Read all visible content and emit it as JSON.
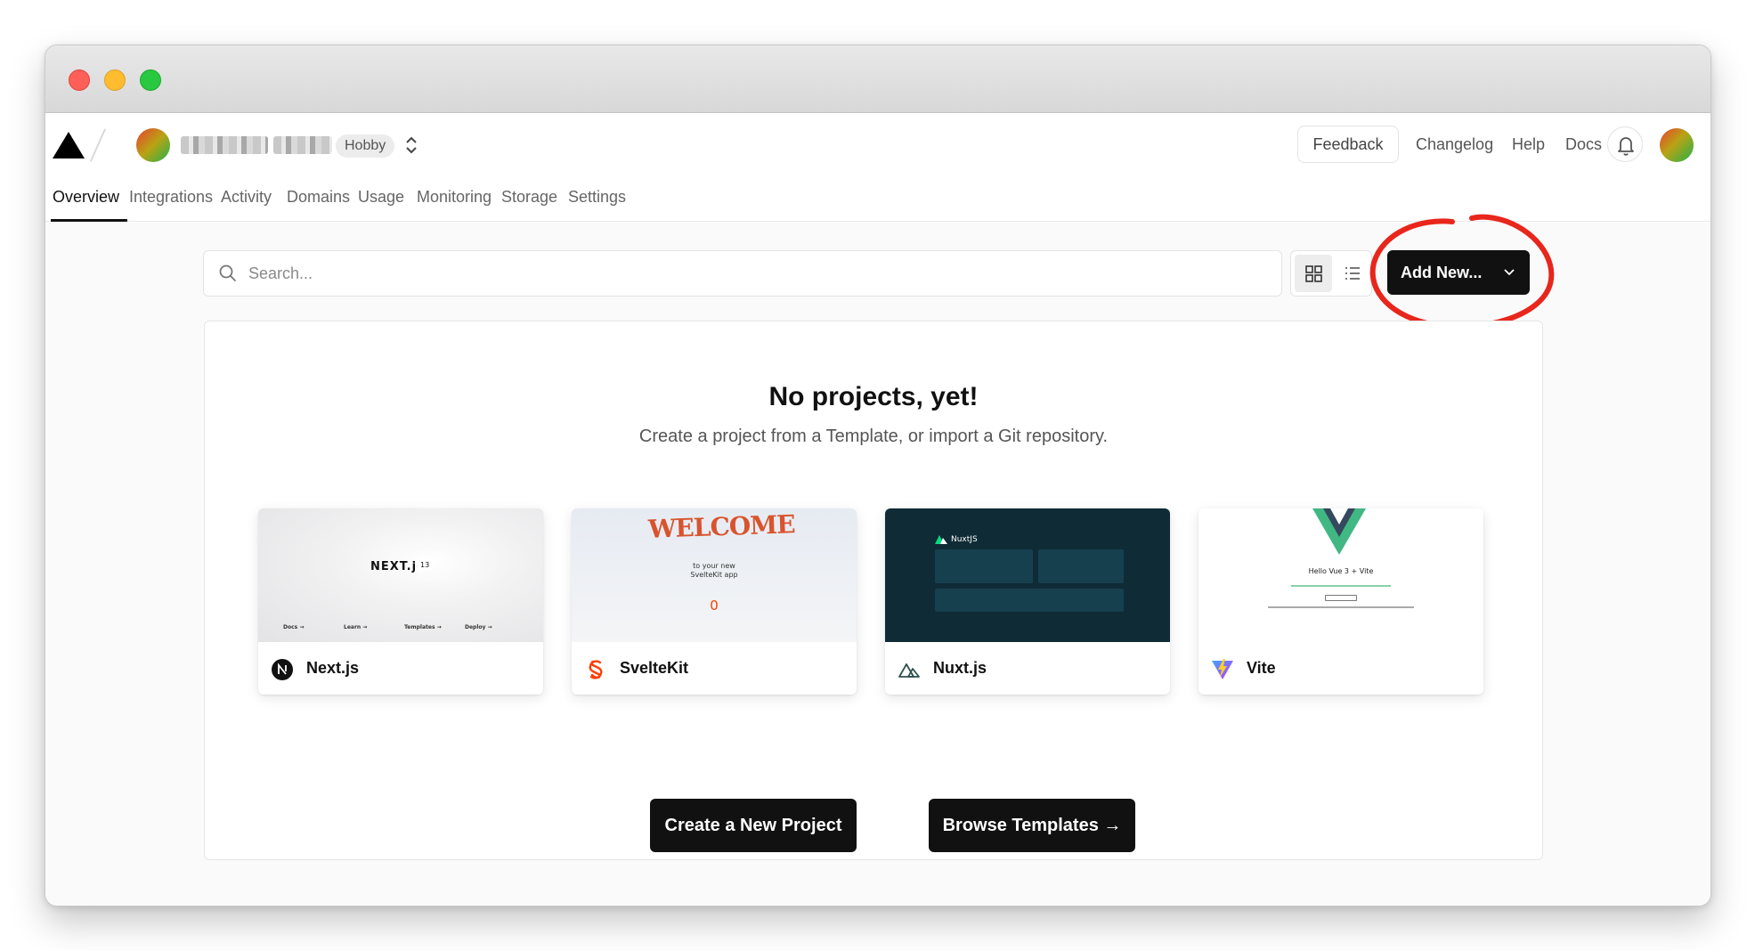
{
  "window": {
    "controls": [
      "close",
      "minimize",
      "zoom"
    ]
  },
  "header": {
    "team": {
      "plan_badge": "Hobby"
    },
    "links": {
      "feedback": "Feedback",
      "changelog": "Changelog",
      "help": "Help",
      "docs": "Docs"
    },
    "icons": {
      "logo": "vercel-triangle-icon",
      "bell": "bell-icon",
      "switcher": "chevron-up-down-icon"
    }
  },
  "tabs": [
    {
      "label": "Overview",
      "active": true
    },
    {
      "label": "Integrations",
      "active": false
    },
    {
      "label": "Activity",
      "active": false
    },
    {
      "label": "Domains",
      "active": false
    },
    {
      "label": "Usage",
      "active": false
    },
    {
      "label": "Monitoring",
      "active": false
    },
    {
      "label": "Storage",
      "active": false
    },
    {
      "label": "Settings",
      "active": false
    }
  ],
  "toolbar": {
    "search": {
      "placeholder": "Search...",
      "value": ""
    },
    "view_mode": "grid",
    "add_new_label": "Add New..."
  },
  "empty_state": {
    "title": "No projects, yet!",
    "subtitle": "Create a project from a Template, or import a Git repository."
  },
  "templates": [
    {
      "name": "Next.js",
      "icon": "nextjs-icon",
      "preview_text": {
        "logo": "NEXT.js",
        "version": "13",
        "links": [
          "Docs →",
          "Learn →",
          "Templates →",
          "Deploy →"
        ]
      }
    },
    {
      "name": "SvelteKit",
      "icon": "svelte-icon",
      "preview_text": {
        "banner": "WELCOME",
        "line1": "to your new",
        "line2": "SvelteKit app",
        "counter": "0"
      }
    },
    {
      "name": "Nuxt.js",
      "icon": "nuxt-icon",
      "preview_text": {
        "brand": "NuxtJS"
      }
    },
    {
      "name": "Vite",
      "icon": "vite-icon",
      "preview_text": {
        "heading": "Hello Vue 3 + Vite"
      }
    }
  ],
  "actions": {
    "create_label": "Create a New Project",
    "browse_label": "Browse Templates →"
  },
  "colors": {
    "accent": "#111111",
    "annotation": "#e8261c",
    "nuxt_bg": "#0f2b36",
    "svelte": "#ff3e00",
    "vue_green": "#41b883",
    "vue_dark": "#35495e"
  }
}
